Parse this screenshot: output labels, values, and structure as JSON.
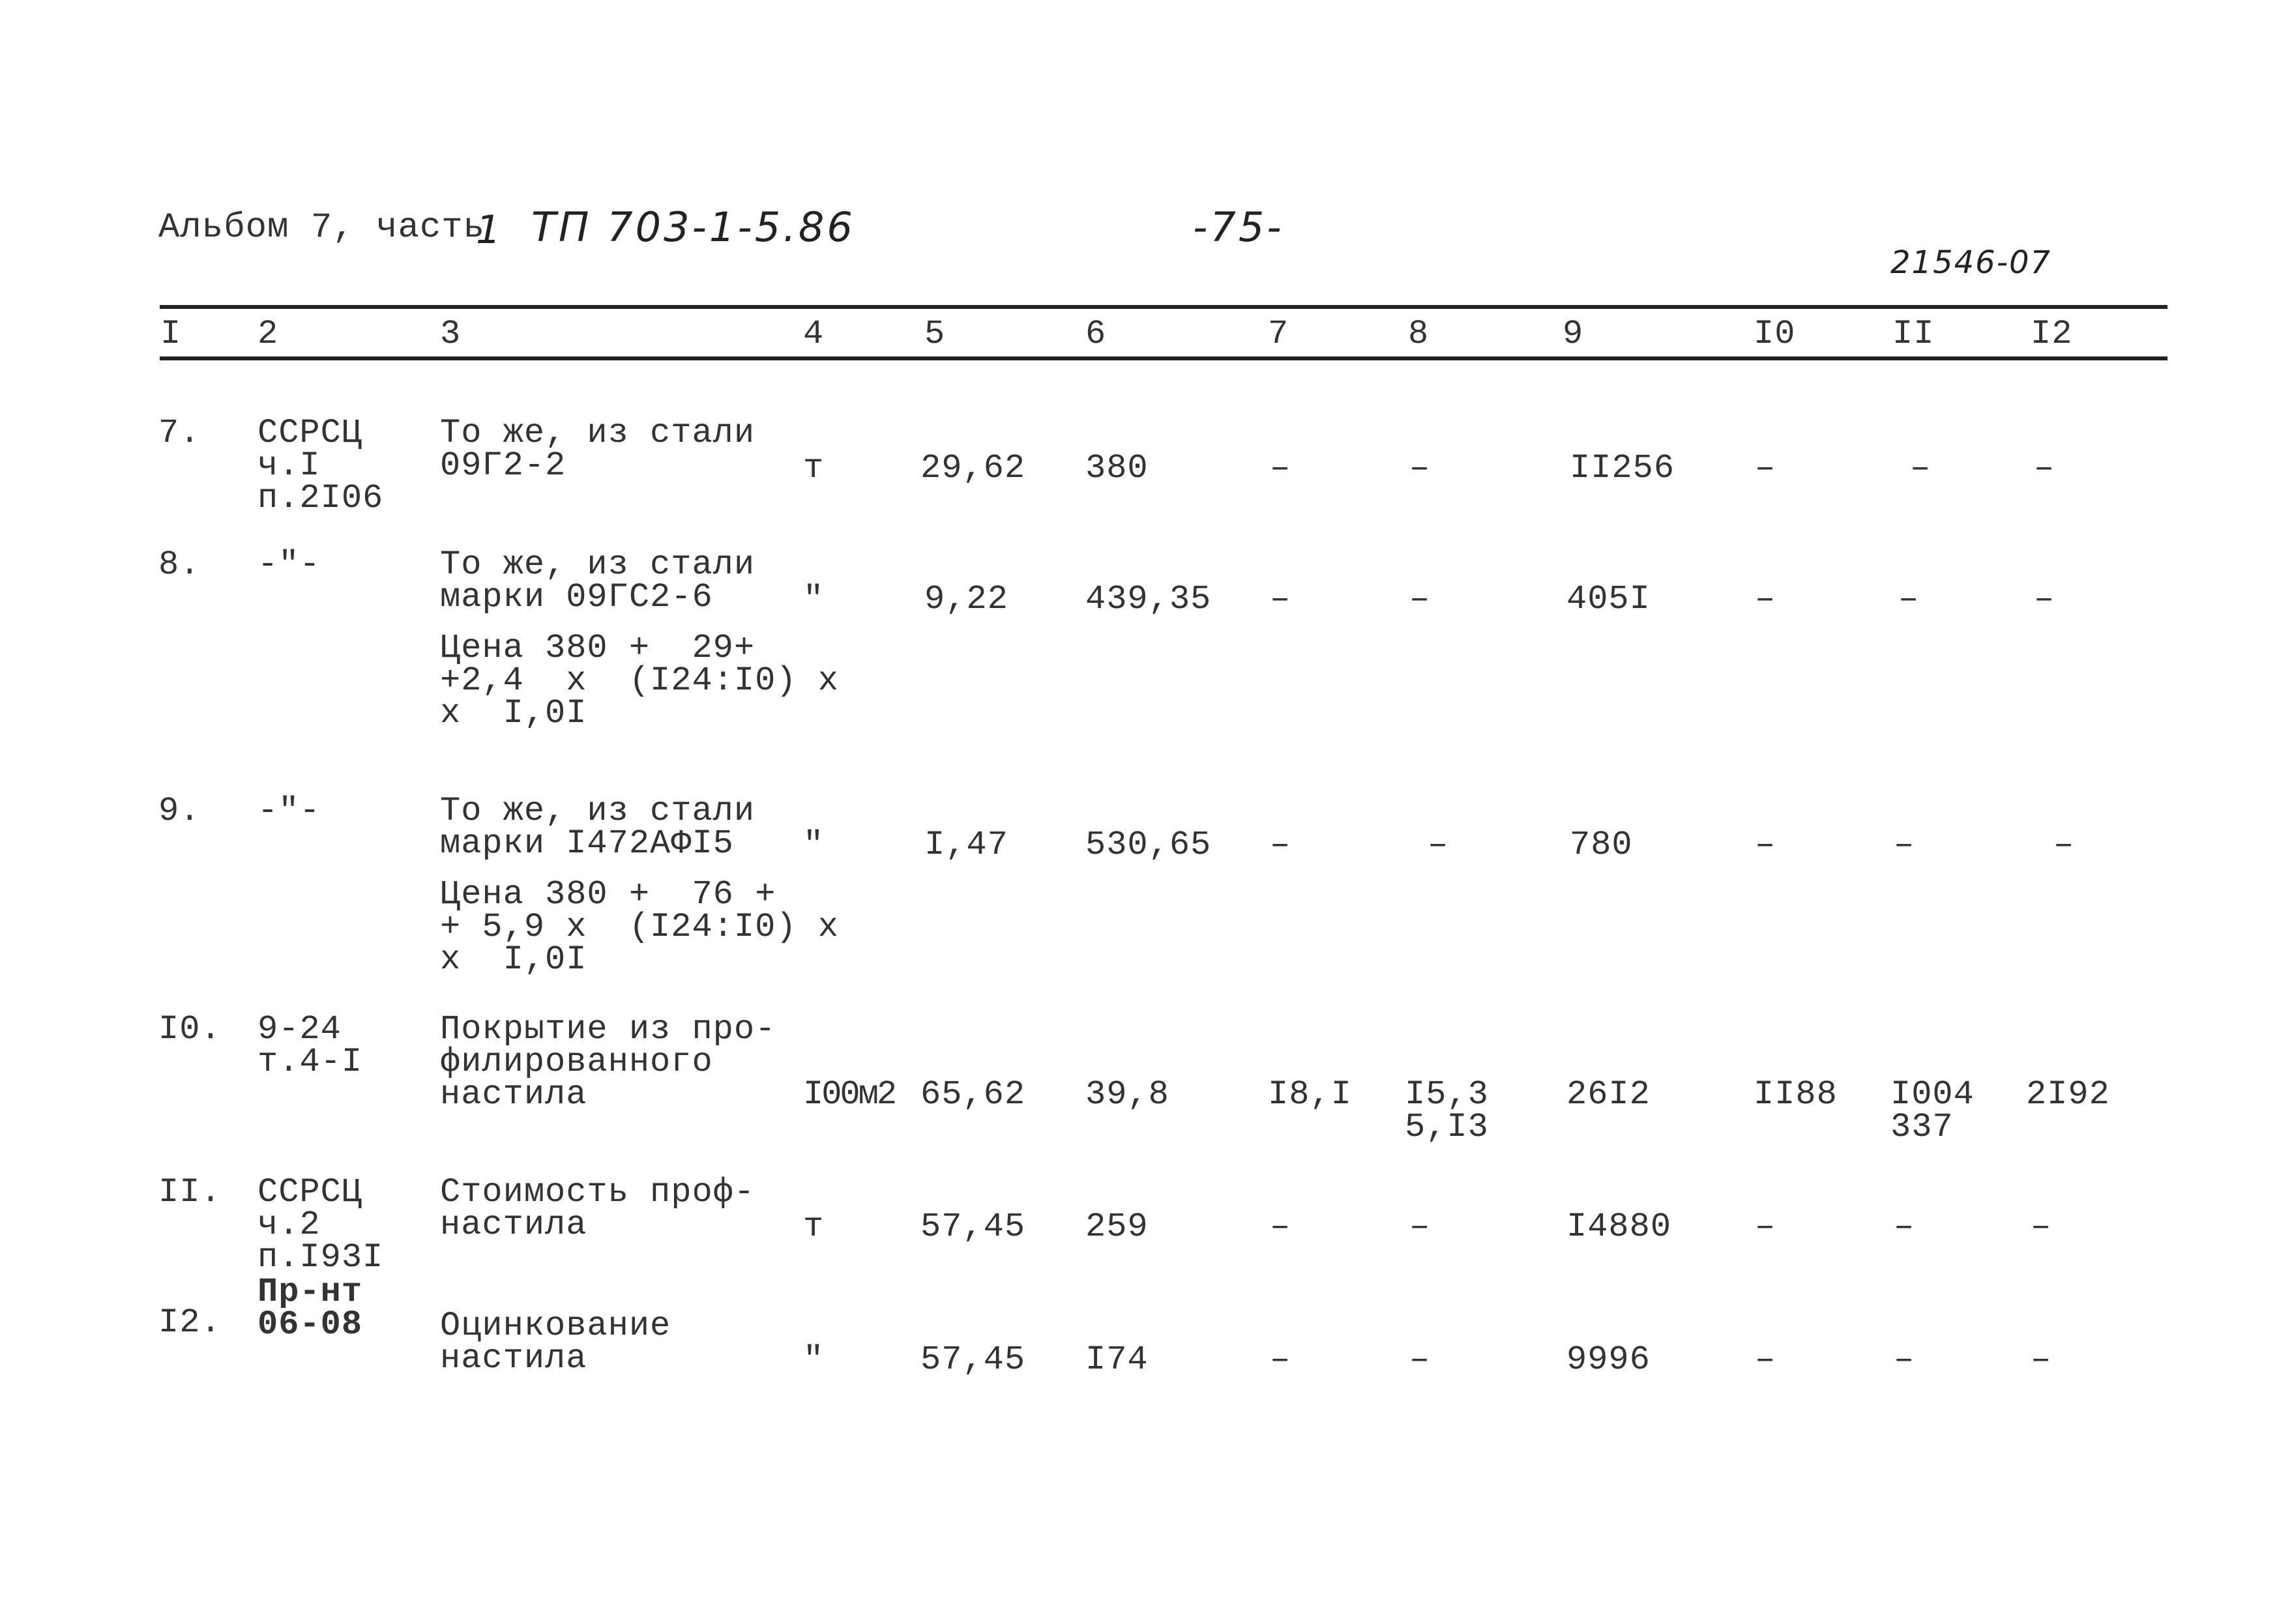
{
  "header": {
    "album": "Альбом 7, часть",
    "part_handwritten": "1",
    "project_code": "ТП 703-1-5.86",
    "page_number": "-75-",
    "doc_code": "21546-07"
  },
  "columns": [
    "I",
    "2",
    "3",
    "4",
    "5",
    "6",
    "7",
    "8",
    "9",
    "I0",
    "II",
    "I2"
  ],
  "rows": [
    {
      "n": "7.",
      "ref": "ССРСЦ\nч.I\nп.2I06",
      "desc": "То же, из стали\n09Г2-2",
      "unit": "т",
      "qty": "29,62",
      "price": "380",
      "c7": "–",
      "c8": "–",
      "total": "II256",
      "c10": "–",
      "c11": "–",
      "c12": "–"
    },
    {
      "n": "8.",
      "ref": "-\"-",
      "desc": "То же, из стали\nмарки 09ГС2-6",
      "note": "Цена 380 +  29+\n+2,4  х  (I24:I0) х\nх  I,0I",
      "unit": "\"",
      "qty": "9,22",
      "price": "439,35",
      "c7": "–",
      "c8": "–",
      "total": "405I",
      "c10": "–",
      "c11": "–",
      "c12": "–"
    },
    {
      "n": "9.",
      "ref": "-\"-",
      "desc": "То же, из стали\nмарки I472АФI5",
      "note": "Цена 380 +  76 +\n+ 5,9 х  (I24:I0) х\nх  I,0I",
      "unit": "\"",
      "qty": "I,47",
      "price": "530,65",
      "c7": "–",
      "c8": "–",
      "total": "780",
      "c10": "–",
      "c11": "–",
      "c12": "–"
    },
    {
      "n": "I0.",
      "ref": "9-24\nт.4-I",
      "desc": "Покрытие из про-\nфилированного\nнастила",
      "unit": "I00м2",
      "qty": "65,62",
      "price": "39,8",
      "c7": "I8,I",
      "c8": "I5,3\n5,I3",
      "total": "26I2",
      "c10": "II88",
      "c11": "I004\n337",
      "c12": "2I92"
    },
    {
      "n": "II.",
      "ref": "ССРСЦ\nч.2\nп.I93I",
      "desc": "Стоимость проф-\nнастила",
      "unit": "т",
      "qty": "57,45",
      "price": "259",
      "c7": "–",
      "c8": "–",
      "total": "I4880",
      "c10": "–",
      "c11": "–",
      "c12": "–"
    },
    {
      "n": "I2.",
      "ref": "Пр-нт\n06-08",
      "desc": "Оцинкование\nнастила",
      "unit": "\"",
      "qty": "57,45",
      "price": "I74",
      "c7": "–",
      "c8": "–",
      "total": "9996",
      "c10": "–",
      "c11": "–",
      "c12": "–"
    }
  ]
}
